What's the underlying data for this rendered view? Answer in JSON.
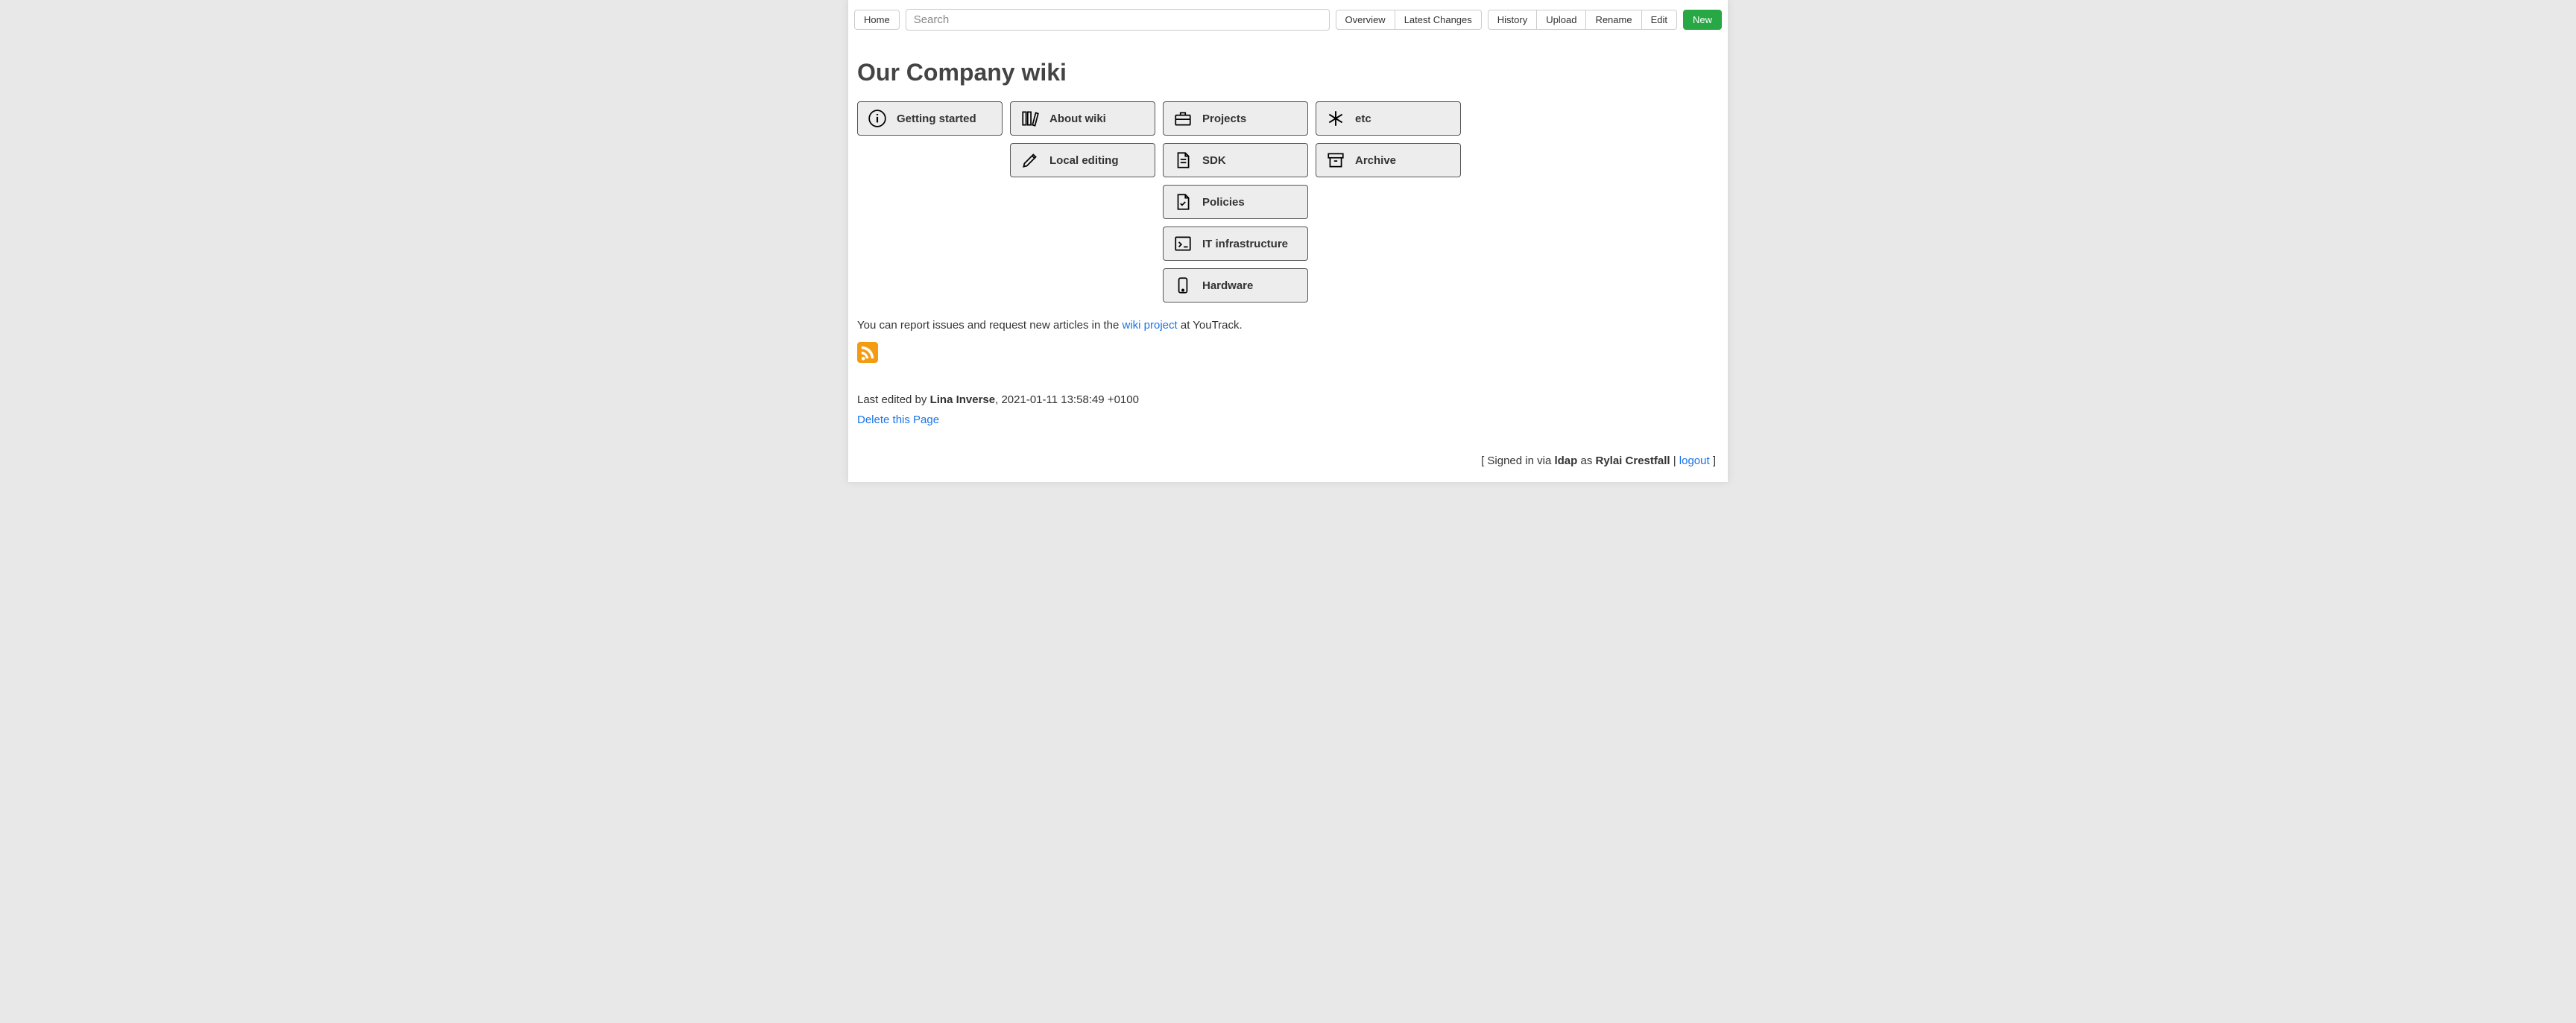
{
  "topbar": {
    "home": "Home",
    "search_placeholder": "Search",
    "overview": "Overview",
    "latest_changes": "Latest Changes",
    "history": "History",
    "upload": "Upload",
    "rename": "Rename",
    "edit": "Edit",
    "new": "New"
  },
  "page_title": "Our Company wiki",
  "tiles": {
    "getting_started": "Getting started",
    "about_wiki": "About wiki",
    "local_editing": "Local editing",
    "projects": "Projects",
    "sdk": "SDK",
    "policies": "Policies",
    "it_infrastructure": "IT infrastructure",
    "hardware": "Hardware",
    "etc": "etc",
    "archive": "Archive"
  },
  "report": {
    "prefix": "You can report issues and request new articles in the ",
    "link": "wiki project",
    "suffix": " at YouTrack."
  },
  "meta": {
    "prefix": "Last edited by ",
    "author": "Lina Inverse",
    "sep": ", ",
    "date": "2021-01-11 13:58:49 +0100"
  },
  "delete_link": "Delete this Page",
  "footer": {
    "b1": "[ ",
    "t1": "Signed in via ",
    "provider": "ldap",
    "t2": " as ",
    "user": "Rylai Crestfall",
    "t3": " | ",
    "logout": "logout",
    "b2": " ]"
  }
}
